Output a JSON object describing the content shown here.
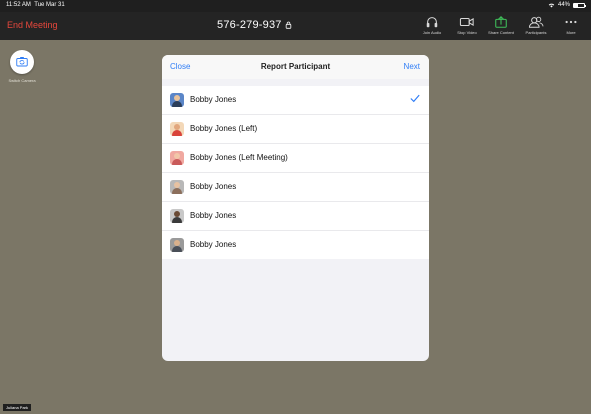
{
  "status_bar": {
    "time": "11:52 AM",
    "date": "Tue Mar 31",
    "battery": "44%"
  },
  "toolbar": {
    "end_meeting": "End Meeting",
    "meeting_id": "576-279-937",
    "buttons": [
      {
        "label": "Join Audio",
        "icon": "headphones-icon"
      },
      {
        "label": "Stop Video",
        "icon": "video-camera-icon"
      },
      {
        "label": "Share Content",
        "icon": "share-icon"
      },
      {
        "label": "Participants",
        "icon": "participants-icon"
      },
      {
        "label": "More",
        "icon": "ellipsis-icon"
      }
    ]
  },
  "switch_camera": {
    "label": "Switch Camera",
    "icon": "switch-camera-icon"
  },
  "name_tag": "Juliana Park",
  "modal": {
    "title": "Report Participant",
    "close": "Close",
    "next": "Next",
    "participants": [
      {
        "name": "Bobby Jones",
        "selected": true
      },
      {
        "name": "Bobby Jones (Left)",
        "selected": false
      },
      {
        "name": "Bobby Jones (Left Meeting)",
        "selected": false
      },
      {
        "name": "Bobby Jones",
        "selected": false
      },
      {
        "name": "Bobby Jones",
        "selected": false
      },
      {
        "name": "Bobby Jones",
        "selected": false
      }
    ]
  },
  "colors": {
    "accent": "#2f7df6",
    "end_meeting": "#e6473c",
    "share_green": "#3fbf5a"
  }
}
